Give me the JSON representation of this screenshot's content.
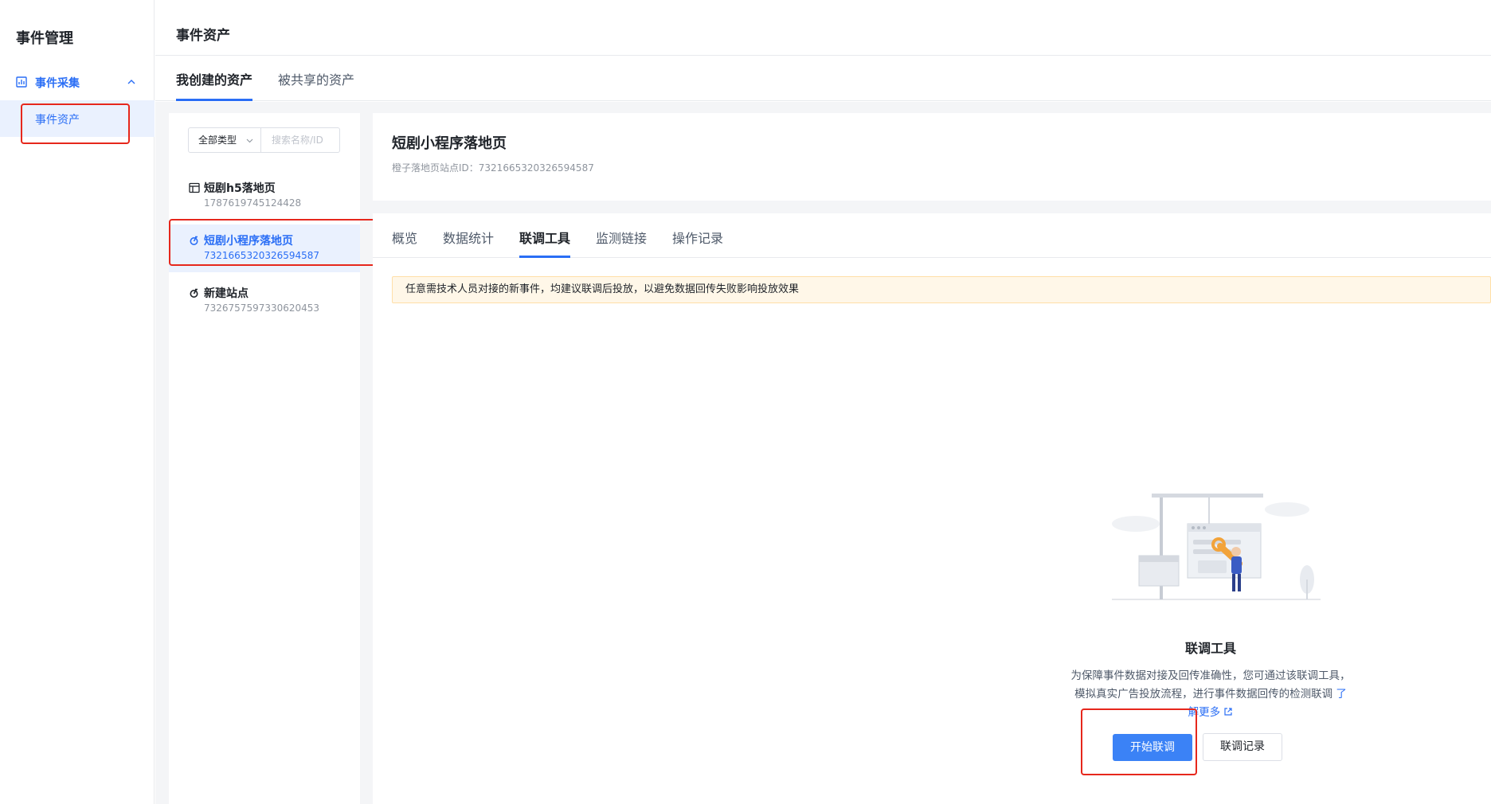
{
  "sidebar": {
    "title": "事件管理",
    "group": {
      "label": "事件采集",
      "icon": "dashboard-icon",
      "expanded": true
    },
    "items": [
      {
        "label": "事件资产",
        "active": true
      }
    ]
  },
  "topbar": {
    "title": "事件资产"
  },
  "asset_tabs": [
    {
      "label": "我创建的资产",
      "active": true
    },
    {
      "label": "被共享的资产",
      "active": false
    }
  ],
  "list": {
    "filter": {
      "type_label": "全部类型",
      "search_placeholder": "搜索名称/ID"
    },
    "items": [
      {
        "name": "短剧h5落地页",
        "id": "1787619745124428",
        "icon": "page-layout-icon",
        "active": false
      },
      {
        "name": "短剧小程序落地页",
        "id": "7321665320326594587",
        "icon": "mini-program-icon",
        "active": true
      },
      {
        "name": "新建站点",
        "id": "7326757597330620453",
        "icon": "mini-program-icon",
        "active": false
      }
    ]
  },
  "detail": {
    "name": "短剧小程序落地页",
    "site_id_text": "橙子落地页站点ID：7321665320326594587",
    "tabs": [
      {
        "label": "概览",
        "active": false
      },
      {
        "label": "数据统计",
        "active": false
      },
      {
        "label": "联调工具",
        "active": true
      },
      {
        "label": "监测链接",
        "active": false
      },
      {
        "label": "操作记录",
        "active": false
      }
    ],
    "notice": "任意需技术人员对接的新事件，均建议联调后投放，以避免数据回传失败影响投放效果",
    "empty": {
      "title": "联调工具",
      "desc": "为保障事件数据对接及回传准确性，您可通过该联调工具，模拟真实广告投放流程，进行事件数据回传的检测联调",
      "link": "了解更多",
      "primary_button": "开始联调",
      "secondary_button": "联调记录"
    }
  },
  "colors": {
    "accent": "#2a6ef5",
    "highlight": "#e6271c",
    "notice_bg": "#fff7e8"
  }
}
